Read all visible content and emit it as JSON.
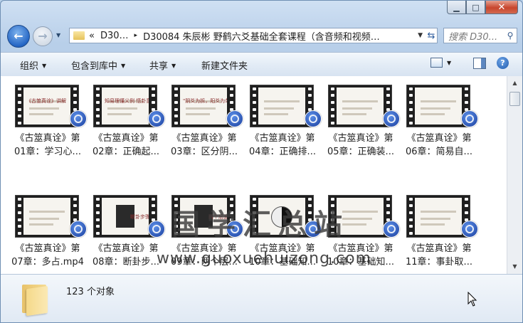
{
  "window": {
    "caption_buttons": [
      "minimize",
      "maximize",
      "close"
    ]
  },
  "nav": {
    "address_segments": [
      "«",
      "D30…",
      "▸",
      "D30084 朱辰彬 野鹤六爻基础全套课程（含音频和视频…"
    ],
    "search_placeholder": "搜索 D30..."
  },
  "toolbar": {
    "organize": "组织",
    "include_in_library": "包含到库中",
    "share": "共享",
    "new_folder": "新建文件夹"
  },
  "files": [
    {
      "line1": "《古筮真诠》第",
      "line2": "01章：学习心...",
      "thumb_text": "《古筮真诠》讲解"
    },
    {
      "line1": "《古筮真诠》第",
      "line2": "02章：正确起...",
      "thumb_text": "知易理懂义例  悟卦意爻辞法"
    },
    {
      "line1": "《古筮真诠》第",
      "line2": "03章：区分阴...",
      "thumb_text": "\"阴爻为拆，阳爻为单\""
    },
    {
      "line1": "《古筮真诠》第",
      "line2": "04章：正确排...",
      "thumb_text": ""
    },
    {
      "line1": "《古筮真诠》第",
      "line2": "05章：正确装...",
      "thumb_text": ""
    },
    {
      "line1": "《古筮真诠》第",
      "line2": "06章：简易自...",
      "thumb_text": ""
    },
    {
      "line1": "《古筮真诠》第",
      "line2": "07章：多占.mp4",
      "thumb_text": ""
    },
    {
      "line1": "《古筮真诠》第",
      "line2": "08章：断卦步...",
      "thumb_text": "断卦步骤"
    },
    {
      "line1": "《古筮真诠》第",
      "line2": "09章：两个层...",
      "thumb_text": "两个层面"
    },
    {
      "line1": "《古筮真诠》第",
      "line2": "10章：基础知...",
      "thumb_text": ""
    },
    {
      "line1": "《古筮真诠》第",
      "line2": "10章：基础知...",
      "thumb_text": ""
    },
    {
      "line1": "《古筮真诠》第",
      "line2": "11章：事卦取...",
      "thumb_text": ""
    }
  ],
  "watermark": {
    "cn": "国学汇总站",
    "en": "www.guoxuehuizong.com"
  },
  "status": {
    "count": "123 个对象"
  },
  "colors": {
    "title_bg": "#b9d1ea",
    "content_bg": "#ffffff",
    "accent": "#2566c5"
  }
}
